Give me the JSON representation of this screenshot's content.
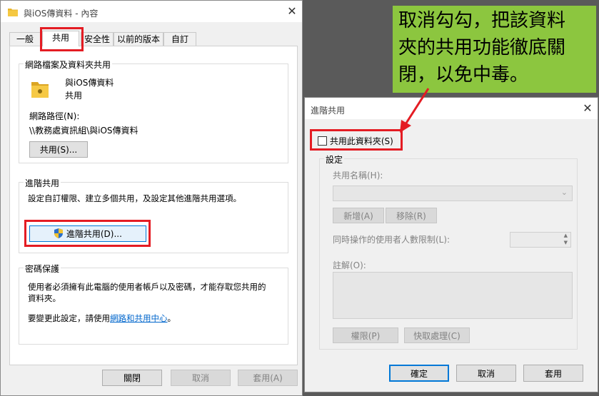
{
  "props_window": {
    "title": "與iOS傳資料 - 內容",
    "close_glyph": "✕",
    "tabs": [
      {
        "label": "一般"
      },
      {
        "label": "共用"
      },
      {
        "label": "安全性"
      },
      {
        "label": "以前的版本"
      },
      {
        "label": "自訂"
      }
    ],
    "network_group": {
      "label": "網路檔案及資料夾共用",
      "folder_name": "與iOS傳資料",
      "share_status": "共用",
      "path_label": "網路路徑(N):",
      "path_value": "\\\\教務處資訊組\\與iOS傳資料",
      "share_button": "共用(S)..."
    },
    "advanced_group": {
      "label": "進階共用",
      "description": "設定自訂權限、建立多個共用，及設定其他進階共用選項。",
      "button": "進階共用(D)..."
    },
    "password_group": {
      "label": "密碼保護",
      "line1": "使用者必須擁有此電腦的使用者帳戶以及密碼，才能存取您共用的",
      "line2": "資料夾。",
      "change_prefix": "要變更此設定，請使用",
      "change_link": "網路和共用中心",
      "change_suffix": "。"
    },
    "footer": {
      "close": "關閉",
      "cancel": "取消",
      "apply": "套用(A)"
    }
  },
  "annotation": {
    "line1": "取消勾勾，把該資料",
    "line2": "夾的共用功能徹底關",
    "line3": "閉，以免中毒。",
    "color": "#8cc63f"
  },
  "advanced_dialog": {
    "title": "進階共用",
    "close_glyph": "✕",
    "share_checkbox": {
      "label": "共用此資料夾(S)",
      "checked": false
    },
    "settings_label": "設定",
    "share_name_label": "共用名稱(H):",
    "add_button": "新增(A)",
    "remove_button": "移除(R)",
    "user_limit_label": "同時操作的使用者人數限制(L):",
    "comment_label": "註解(O):",
    "permissions_button": "權限(P)",
    "caching_button": "快取處理(C)",
    "ok": "確定",
    "cancel": "取消",
    "apply": "套用"
  },
  "colors": {
    "highlight_red": "#e41c23",
    "accent_blue": "#0078d7",
    "link_blue": "#0066cc"
  }
}
